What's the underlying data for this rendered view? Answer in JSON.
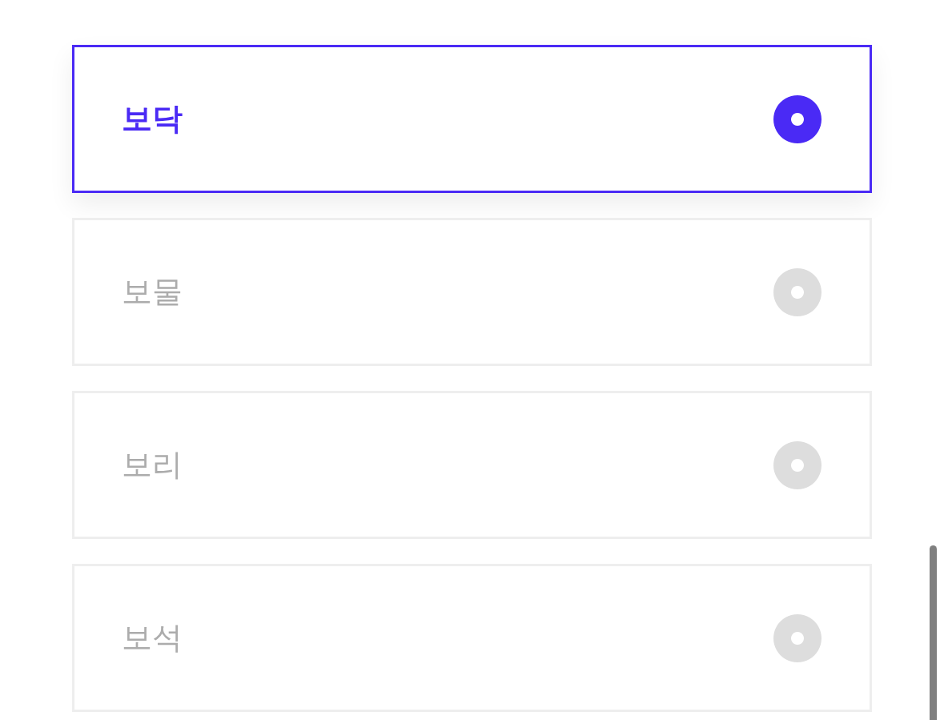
{
  "options": [
    {
      "label": "보닥",
      "selected": true
    },
    {
      "label": "보물",
      "selected": false
    },
    {
      "label": "보리",
      "selected": false
    },
    {
      "label": "보석",
      "selected": false
    }
  ]
}
